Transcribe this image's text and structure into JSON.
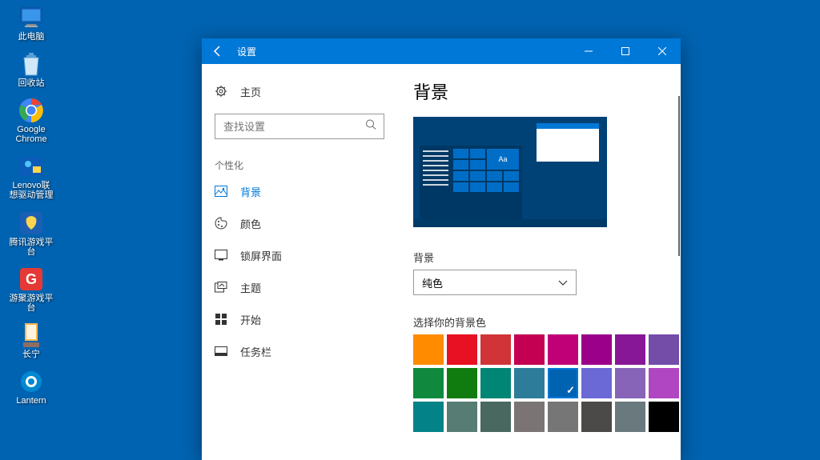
{
  "desktop": {
    "icons": [
      {
        "label": "此电脑",
        "icon": "pc"
      },
      {
        "label": "回收站",
        "icon": "recycle"
      },
      {
        "label": "Google Chrome",
        "icon": "chrome"
      },
      {
        "label": "Lenovo联想驱动管理",
        "icon": "lenovo"
      },
      {
        "label": "腾讯游戏平台",
        "icon": "tencent"
      },
      {
        "label": "游聚游戏平台",
        "icon": "youju"
      },
      {
        "label": "长宁",
        "icon": "changning"
      },
      {
        "label": "Lantern",
        "icon": "lantern"
      }
    ]
  },
  "window": {
    "title": "设置"
  },
  "sidebar": {
    "home": "主页",
    "search_placeholder": "查找设置",
    "category": "个性化",
    "items": [
      {
        "label": "背景"
      },
      {
        "label": "颜色"
      },
      {
        "label": "锁屏界面"
      },
      {
        "label": "主题"
      },
      {
        "label": "开始"
      },
      {
        "label": "任务栏"
      }
    ]
  },
  "content": {
    "heading": "背景",
    "preview_sample": "Aa",
    "bg_label": "背景",
    "bg_value": "纯色",
    "color_label": "选择你的背景色",
    "colors": [
      "#ff8c00",
      "#e81123",
      "#d13438",
      "#c30052",
      "#bf0077",
      "#9a0089",
      "#881798",
      "#744da9",
      "#10893e",
      "#107c10",
      "#018574",
      "#2d7d9a",
      "#0063b1",
      "#6b69d6",
      "#8764b8",
      "#b146c2",
      "#038387",
      "#567c73",
      "#486860",
      "#7a7574",
      "#767676",
      "#4c4a48",
      "#69797e",
      "#000000"
    ],
    "selected_color_index": 12
  }
}
